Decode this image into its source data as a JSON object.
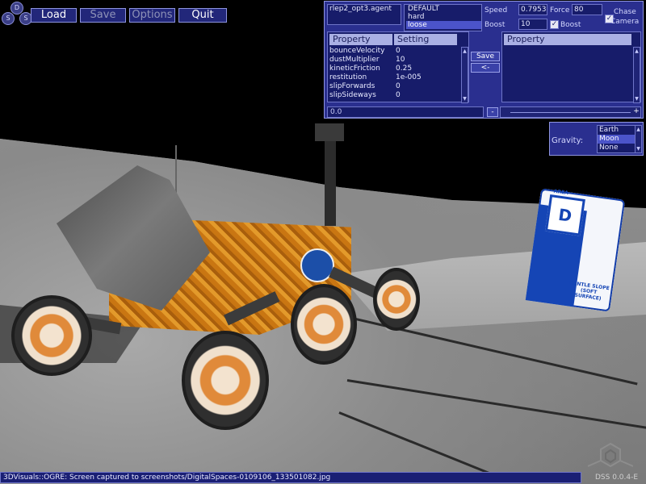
{
  "toolbar": {
    "logo_letters": [
      "D",
      "S",
      "S"
    ],
    "load": "Load",
    "save": "Save",
    "options": "Options",
    "quit": "Quit"
  },
  "property_editor": {
    "agent_file": "rlep2_opt3.agent",
    "presets": [
      "DEFAULT",
      "hard",
      "loose"
    ],
    "selected_preset": "loose",
    "speed_label": "Speed",
    "speed_value": "0.79536",
    "force_label": "Force",
    "force_value": "80",
    "boost_label": "Boost",
    "boost_value": "10",
    "boost_checkbox_label": "Boost",
    "boost_checked": true,
    "chase_camera_label_1": "Chase",
    "chase_camera_label_2": "Camera",
    "chase_camera_checked": true,
    "left_table": {
      "headers": [
        "Property",
        "Setting"
      ],
      "rows": [
        [
          "bounceVelocity",
          "0"
        ],
        [
          "dustMultiplier",
          "10"
        ],
        [
          "kineticFriction",
          "0.25"
        ],
        [
          "restitution",
          "1e-005"
        ],
        [
          "slipForwards",
          "0"
        ],
        [
          "slipSideways",
          "0"
        ]
      ]
    },
    "save_button": "Save",
    "move_left_button": "<-",
    "right_table": {
      "headers": [
        "Property"
      ]
    },
    "edit_value": "0.0",
    "minus_button": "-",
    "plus_button": "+"
  },
  "gravity": {
    "label": "Gravity:",
    "options": [
      "Earth",
      "Moon",
      "None"
    ],
    "selected": "Moon"
  },
  "status_bar": {
    "message": "3DVisuals::OGRE: Screen captured to screenshots/DigitalSpaces-0109106_133501082.jpg",
    "version": "DSS 0.0.4-E"
  },
  "sign": {
    "top": "AREA",
    "letter": "D",
    "line1": "GENTLE SLOPE",
    "line2": "(SOFT SURFACE)"
  },
  "colors": {
    "panel_bg": "#2a2f8f",
    "panel_border": "#8e94e0",
    "field_bg": "#171c6a",
    "selection": "#4b54c9",
    "rover_orange": "#e39a2b",
    "sign_blue": "#1545b5"
  }
}
